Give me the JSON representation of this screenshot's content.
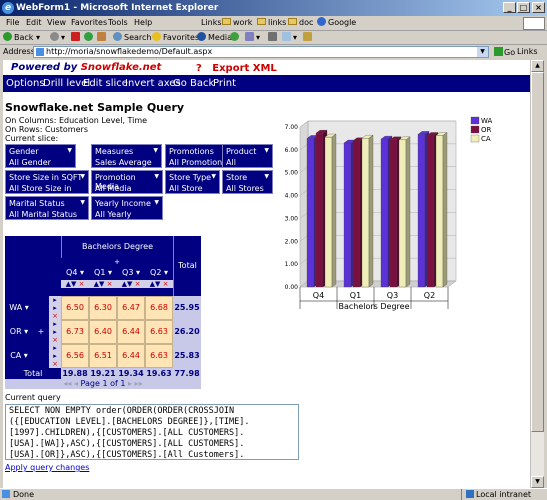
{
  "window": {
    "title": "WebForm1 - Microsoft Internet Explorer",
    "min": "_",
    "max": "□",
    "close": "×"
  },
  "menubar": {
    "items": [
      "File",
      "Edit",
      "View",
      "Favorites",
      "Tools",
      "Help"
    ],
    "links": [
      "Links",
      "work",
      "links",
      "doc",
      "Google"
    ]
  },
  "toolbar": {
    "back": "Back",
    "search": "Search",
    "favorites": "Favorites",
    "media": "Media"
  },
  "address": {
    "label": "Address",
    "url": "http://moria/snowflakedemo/Default.aspx",
    "go": "Go",
    "links": "Links"
  },
  "status": {
    "text": "Done",
    "zone": "Local intranet"
  },
  "page": {
    "powered_prefix": "Powered by ",
    "powered_brand": "Snowflake.net",
    "export_q": "?",
    "export": "Export XML",
    "nav": [
      "Options",
      "Drill level",
      "Edit slice",
      "Invert axes",
      "Go Back",
      "Print"
    ],
    "title": "Snowflake.net Sample Query",
    "on_columns": "On Columns: Education Level, Time",
    "on_rows": "On Rows: Customers",
    "current_slice": "Current slice:",
    "slices": [
      {
        "header": "Gender",
        "value": "All Gender"
      },
      {
        "header": "Measures",
        "value": "Sales Average"
      },
      {
        "header": "Promotions",
        "value": "All Promotions"
      },
      {
        "header": "Product",
        "value": "All Products"
      },
      {
        "header": "Store Size in SQFT",
        "value": "All Store Size in SQFT"
      },
      {
        "header": "Promotion Media",
        "value": "All Media"
      },
      {
        "header": "Store Type",
        "value": "All Store Type"
      },
      {
        "header": "Store",
        "value": "All Stores"
      },
      {
        "header": "Marital Status",
        "value": "All Marital Status"
      },
      {
        "header": "Yearly Income",
        "value": "All Yearly Income"
      }
    ],
    "grid": {
      "col_group": "Bachelors Degree",
      "total_label": "Total",
      "cols": [
        "Q4",
        "Q1",
        "Q3",
        "Q2"
      ],
      "rows": [
        {
          "label": "WA",
          "values": [
            "6.50",
            "6.30",
            "6.47",
            "6.68"
          ],
          "total": "25.95"
        },
        {
          "label": "OR",
          "values": [
            "6.73",
            "6.40",
            "6.44",
            "6.63"
          ],
          "total": "26.20"
        },
        {
          "label": "CA",
          "values": [
            "6.56",
            "6.51",
            "6.44",
            "6.63"
          ],
          "total": "25.83"
        }
      ],
      "row_total_label": "Total",
      "col_totals": [
        "19.88",
        "19.21",
        "19.34",
        "19.63"
      ],
      "grand_total": "77.98",
      "pager": {
        "prefix": "Page",
        "current": "1",
        "of": "of",
        "total": "1"
      }
    },
    "query_label": "Current query",
    "query": "SELECT NON EMPTY order(ORDER(ORDER(CROSSJOIN\n({[EDUCATION LEVEL].[BACHELORS DEGREE]},[TIME].\n[1997].CHILDREN),{[CUSTOMERS].[ALL CUSTOMERS].\n[USA].[WA]},ASC),{[CUSTOMERS].[ALL CUSTOMERS].\n[USA].[OR]},ASC),{[CUSTOMERS].[All Customers].",
    "apply": "Apply query changes"
  },
  "chart_data": {
    "type": "bar",
    "categories": [
      "Q4",
      "Q1",
      "Q3",
      "Q2"
    ],
    "series": [
      {
        "name": "WA",
        "values": [
          6.5,
          6.3,
          6.47,
          6.68
        ],
        "color": "#5a32d8"
      },
      {
        "name": "OR",
        "values": [
          6.73,
          6.4,
          6.44,
          6.63
        ],
        "color": "#7a1040"
      },
      {
        "name": "CA",
        "values": [
          6.56,
          6.51,
          6.44,
          6.63
        ],
        "color": "#f0eeb8"
      }
    ],
    "xlabel": "Bachelors Degree",
    "ylim": [
      0,
      7
    ],
    "yticks": [
      "7.00",
      "6.00",
      "5.00",
      "4.00",
      "3.00",
      "2.00",
      "1.00",
      "0.00"
    ],
    "legend": "right",
    "grid": true
  }
}
